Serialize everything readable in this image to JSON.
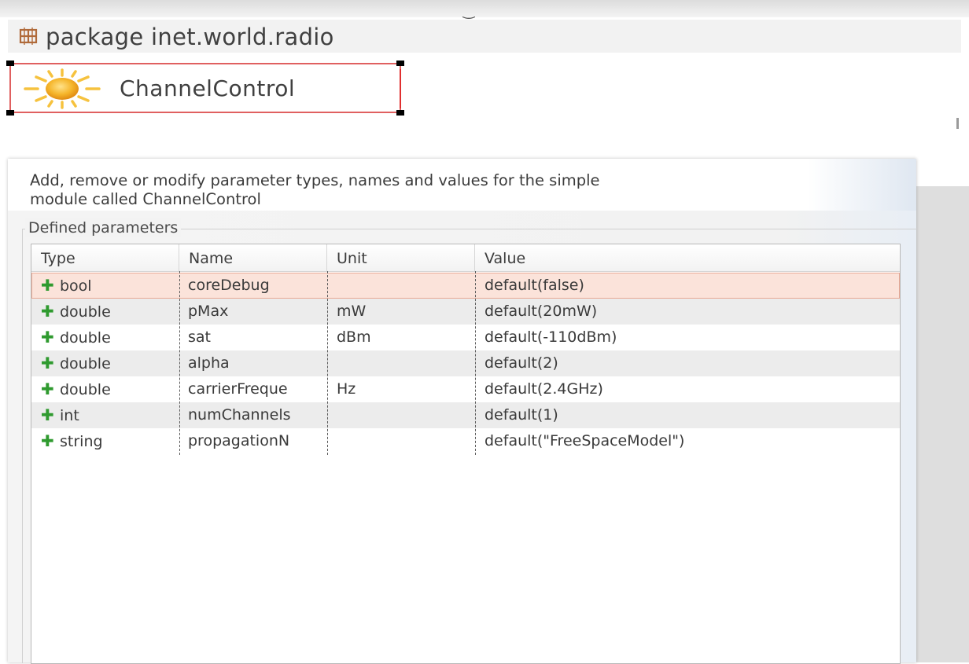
{
  "package": {
    "icon": "package-icon",
    "label": "package inet.world.radio"
  },
  "module": {
    "icon": "sun-icon",
    "name": "ChannelControl"
  },
  "dialog": {
    "description_line1": "Add, remove or modify parameter types, names and values for the simple",
    "description_line2": "module called ChannelControl",
    "group_label": "Defined parameters"
  },
  "table": {
    "headers": [
      "Type",
      "Name",
      "Unit",
      "Value"
    ],
    "rows": [
      {
        "type": "bool",
        "name": "coreDebug",
        "unit": "",
        "value": "default(false)",
        "selected": true
      },
      {
        "type": "double",
        "name": "pMax",
        "unit": "mW",
        "value": "default(20mW)"
      },
      {
        "type": "double",
        "name": "sat",
        "unit": "dBm",
        "value": "default(-110dBm)"
      },
      {
        "type": "double",
        "name": "alpha",
        "unit": "",
        "value": "default(2)"
      },
      {
        "type": "double",
        "name": "carrierFreque",
        "unit": "Hz",
        "value": "default(2.4GHz)"
      },
      {
        "type": "int",
        "name": "numChannels",
        "unit": "",
        "value": "default(1)"
      },
      {
        "type": "string",
        "name": "propagationN",
        "unit": "",
        "value": "default(\"FreeSpaceModel\")"
      }
    ],
    "row_icon": "plus-icon"
  },
  "colors": {
    "selection_fill": "#fbe3da",
    "selection_border": "#e06060",
    "plus_green": "#2f9a2f",
    "sun_orange": "#f2a21b"
  }
}
